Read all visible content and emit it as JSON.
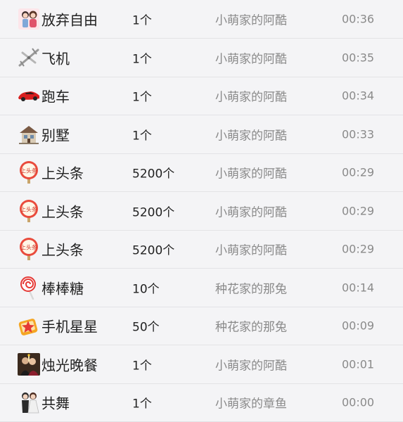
{
  "gifts": [
    {
      "icon": "couple-icon",
      "name": "放弃自由",
      "qty": "1个",
      "sender": "小萌家的阿酷",
      "time": "00:36"
    },
    {
      "icon": "airplane-icon",
      "name": "飞机",
      "qty": "1个",
      "sender": "小萌家的阿酷",
      "time": "00:35"
    },
    {
      "icon": "sports-car-icon",
      "name": "跑车",
      "qty": "1个",
      "sender": "小萌家的阿酷",
      "time": "00:34"
    },
    {
      "icon": "villa-icon",
      "name": "别墅",
      "qty": "1个",
      "sender": "小萌家的阿酷",
      "time": "00:33"
    },
    {
      "icon": "headline-sign-icon",
      "name": "上头条",
      "qty": "5200个",
      "sender": "小萌家的阿酷",
      "time": "00:29"
    },
    {
      "icon": "headline-sign-icon",
      "name": "上头条",
      "qty": "5200个",
      "sender": "小萌家的阿酷",
      "time": "00:29"
    },
    {
      "icon": "headline-sign-icon",
      "name": "上头条",
      "qty": "5200个",
      "sender": "小萌家的阿酷",
      "time": "00:29"
    },
    {
      "icon": "lollipop-icon",
      "name": "棒棒糖",
      "qty": "10个",
      "sender": "种花家的那兔",
      "time": "00:14"
    },
    {
      "icon": "phone-star-icon",
      "name": "手机星星",
      "qty": "50个",
      "sender": "种花家的那兔",
      "time": "00:09"
    },
    {
      "icon": "candle-dinner-icon",
      "name": "烛光晚餐",
      "qty": "1个",
      "sender": "小萌家的阿酷",
      "time": "00:01"
    },
    {
      "icon": "dance-couple-icon",
      "name": "共舞",
      "qty": "1个",
      "sender": "小萌家的章鱼",
      "time": "00:00"
    }
  ]
}
